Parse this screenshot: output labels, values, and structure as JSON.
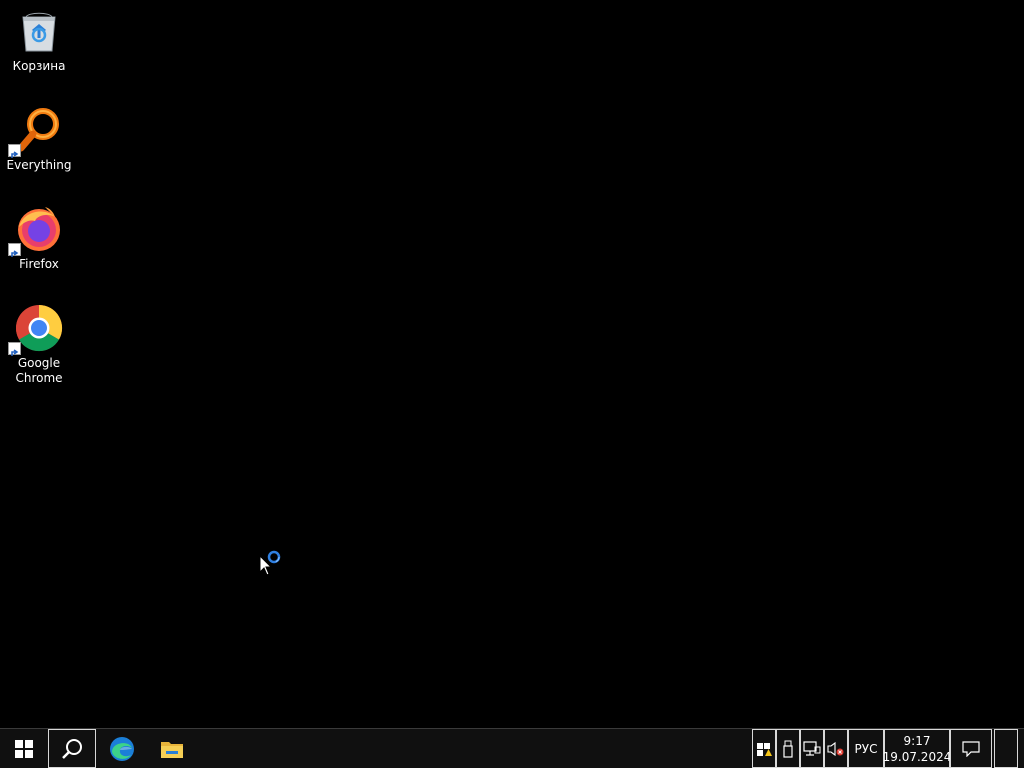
{
  "desktop": {
    "icons": [
      {
        "label": "Корзина",
        "icon": "recycle-bin-icon",
        "shortcut": false
      },
      {
        "label": "Everything",
        "icon": "everything-search-icon",
        "shortcut": true
      },
      {
        "label": "Firefox",
        "icon": "firefox-icon",
        "shortcut": true
      },
      {
        "label": "Google Chrome",
        "icon": "chrome-icon",
        "shortcut": true
      }
    ]
  },
  "taskbar": {
    "start_icon": "windows-logo-icon",
    "search_icon": "search-icon",
    "pinned": [
      {
        "icon": "edge-icon"
      },
      {
        "icon": "file-explorer-icon"
      }
    ],
    "tray": {
      "icons": [
        "security-warning-icon",
        "usb-device-icon",
        "network-icon",
        "volume-muted-icon"
      ],
      "language": "РУС",
      "time": "9:17",
      "date": "19.07.2024",
      "notification_icon": "action-center-icon"
    }
  },
  "cursor": {
    "state": "busy",
    "icon": "busy-pointer-icon"
  },
  "colors": {
    "background": "#000000",
    "taskbar": "#101010",
    "accent": "#3a8ee6"
  }
}
